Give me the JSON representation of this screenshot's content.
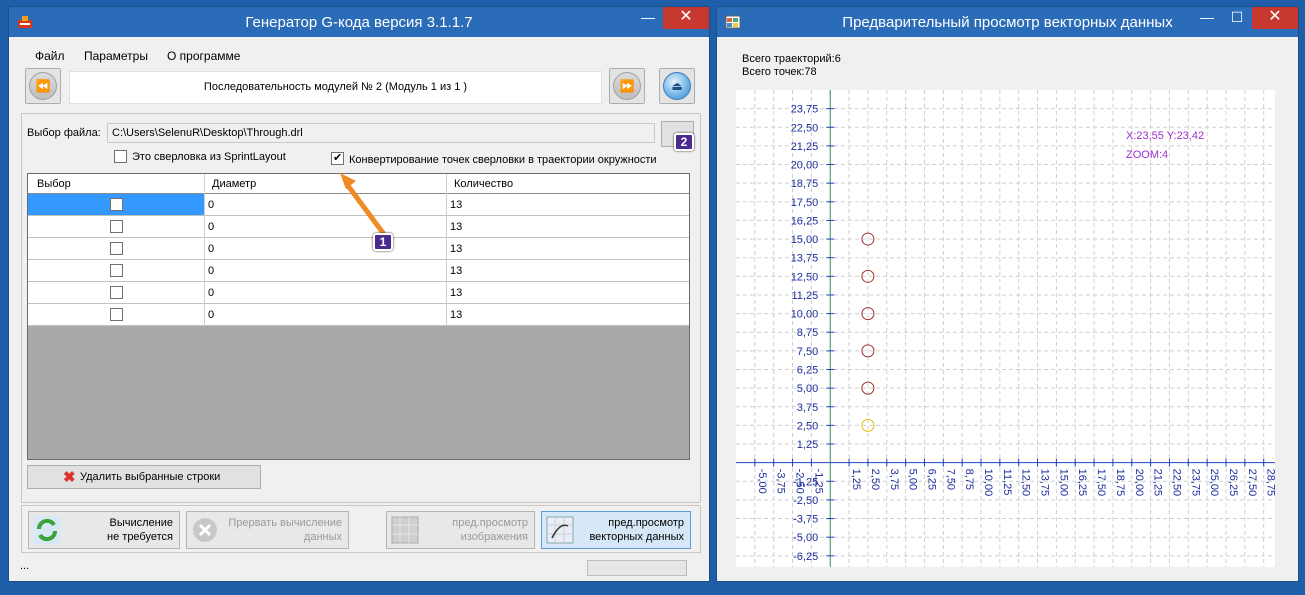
{
  "left_window": {
    "title": "Генератор G-кода версия 3.1.1.7",
    "controls": {
      "minimize": "—",
      "close": "✕"
    },
    "menu": [
      "Файл",
      "Параметры",
      "О программе"
    ],
    "module_label": "Последовательность модулей № 2 (Модуль 1 из 1 )",
    "nav_prev_icon": "⏪",
    "nav_next_icon": "⏩",
    "eject_icon": "⏏",
    "file_label": "Выбор файла:",
    "file_path": "C:\\Users\\SelenuR\\Desktop\\Through.drl",
    "checkbox_sprint": {
      "label": "Это сверловка из SprintLayout",
      "checked": false
    },
    "checkbox_convert": {
      "label": "Конвертирование точек сверловки в траектории окружности",
      "checked": true
    },
    "table": {
      "columns": [
        "Выбор",
        "Диаметр",
        "Количество"
      ],
      "rows": [
        {
          "selected": false,
          "diameter": "0",
          "count": "13"
        },
        {
          "selected": false,
          "diameter": "0",
          "count": "13"
        },
        {
          "selected": false,
          "diameter": "0",
          "count": "13"
        },
        {
          "selected": false,
          "diameter": "0",
          "count": "13"
        },
        {
          "selected": false,
          "diameter": "0",
          "count": "13"
        },
        {
          "selected": false,
          "diameter": "0",
          "count": "13"
        }
      ]
    },
    "delete_rows_label": "Удалить выбранные строки",
    "buttons": {
      "calc": "Вычисление\nне требуется",
      "abort": "Прервать вычисление\nданных",
      "preview_image": "пред.просмотр\nизображения",
      "preview_vector": "пред.просмотр\nвекторных данных"
    },
    "status_text": "...",
    "callouts": [
      "1",
      "2"
    ]
  },
  "right_window": {
    "title": "Предварительный просмотр векторных данных",
    "controls": {
      "minimize": "—",
      "maximize": "☐",
      "close": "✕"
    },
    "trajectories": "Всего траекторий:6",
    "points": "Всего точек:78",
    "coords": "X:23,55 Y:23,42",
    "zoom": "ZOOM:4"
  },
  "chart_data": {
    "type": "scatter",
    "y_ticks": [
      "23,75",
      "22,50",
      "21,25",
      "20,00",
      "18,75",
      "17,50",
      "16,25",
      "15,00",
      "13,75",
      "12,50",
      "11,25",
      "10,00",
      "8,75",
      "7,50",
      "6,25",
      "5,00",
      "3,75",
      "2,50",
      "1,25",
      "-1,25",
      "-2,50",
      "-3,75",
      "-5,00",
      "-6,25"
    ],
    "x_ticks": [
      "-5,00",
      "-3,75",
      "-2,50",
      "-1,25",
      "1,25",
      "2,50",
      "3,75",
      "5,00",
      "6,25",
      "7,50",
      "8,75",
      "10,00",
      "11,25",
      "12,50",
      "13,75",
      "15,00",
      "16,25",
      "17,50",
      "18,75",
      "20,00",
      "21,25",
      "22,50",
      "23,75",
      "25,00",
      "26,25",
      "27,50",
      "28,75"
    ],
    "y_values": [
      -6.25,
      -5,
      -3.75,
      -2.5,
      -1.25,
      1.25,
      2.5,
      3.75,
      5,
      6.25,
      7.5,
      8.75,
      10,
      11.25,
      12.5,
      13.75,
      15,
      16.25,
      17.5,
      18.75,
      20,
      21.25,
      22.5,
      23.75
    ],
    "x_values": [
      -5,
      -3.75,
      -2.5,
      -1.25,
      1.25,
      2.5,
      3.75,
      5,
      6.25,
      7.5,
      8.75,
      10,
      11.25,
      12.5,
      13.75,
      15,
      16.25,
      17.5,
      18.75,
      20,
      21.25,
      22.5,
      23.75,
      25,
      26.25,
      27.5,
      28.75
    ],
    "points": [
      {
        "x": 2.5,
        "y": 15.0,
        "color": "#a03030"
      },
      {
        "x": 2.5,
        "y": 12.5,
        "color": "#a03030"
      },
      {
        "x": 2.5,
        "y": 10.0,
        "color": "#a03030"
      },
      {
        "x": 2.5,
        "y": 7.5,
        "color": "#a03030"
      },
      {
        "x": 2.5,
        "y": 5.0,
        "color": "#a03030"
      },
      {
        "x": 2.5,
        "y": 2.5,
        "color": "#e0c000"
      }
    ],
    "xlim": [
      -6.25,
      29.5
    ],
    "ylim": [
      -7.0,
      25.0
    ],
    "grid": true
  }
}
